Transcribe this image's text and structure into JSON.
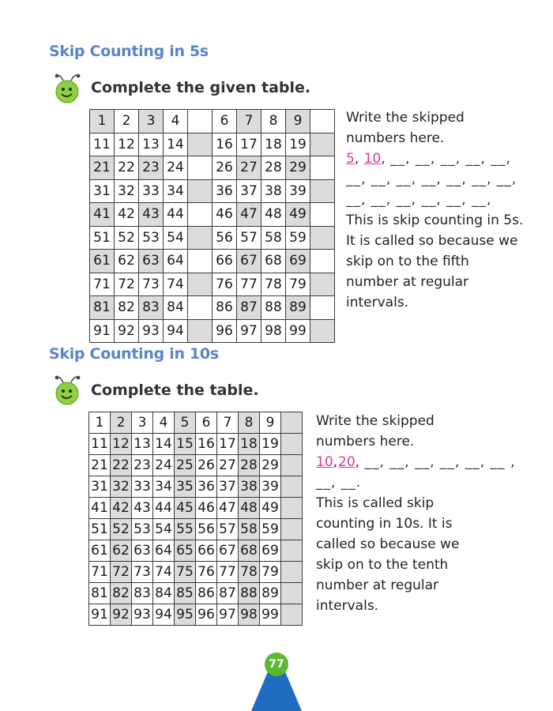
{
  "section1": {
    "title": "Skip Counting in 5s",
    "instruction": "Complete the given table.",
    "rows": [
      [
        "1",
        "2",
        "3",
        "4",
        "",
        "6",
        "7",
        "8",
        "9",
        ""
      ],
      [
        "11",
        "12",
        "13",
        "14",
        "",
        "16",
        "17",
        "18",
        "19",
        ""
      ],
      [
        "21",
        "22",
        "23",
        "24",
        "",
        "26",
        "27",
        "28",
        "29",
        ""
      ],
      [
        "31",
        "32",
        "33",
        "34",
        "",
        "36",
        "37",
        "38",
        "39",
        ""
      ],
      [
        "41",
        "42",
        "43",
        "44",
        "",
        "46",
        "47",
        "48",
        "49",
        ""
      ],
      [
        "51",
        "52",
        "53",
        "54",
        "",
        "56",
        "57",
        "58",
        "59",
        ""
      ],
      [
        "61",
        "62",
        "63",
        "64",
        "",
        "66",
        "67",
        "68",
        "69",
        ""
      ],
      [
        "71",
        "72",
        "73",
        "74",
        "",
        "76",
        "77",
        "78",
        "79",
        ""
      ],
      [
        "81",
        "82",
        "83",
        "84",
        "",
        "86",
        "87",
        "88",
        "89",
        ""
      ],
      [
        "91",
        "92",
        "93",
        "94",
        "",
        "96",
        "97",
        "98",
        "99",
        ""
      ]
    ],
    "side_heading": [
      "Write the skipped",
      "numbers here."
    ],
    "answers": [
      "5",
      "10"
    ],
    "blank_line_1": "__, __, __, __, __,",
    "blank_line_2": "__, __, __, __, __, __, __,",
    "blank_line_3": "__, __, __, __, __, __,",
    "explanation": [
      "This is skip counting in 5s.",
      "It is called so because we",
      "skip on to the fifth",
      "number at regular",
      "intervals."
    ]
  },
  "section2": {
    "title": "Skip Counting in 10s",
    "instruction": "Complete the table.",
    "rows": [
      [
        "1",
        "2",
        "3",
        "4",
        "5",
        "6",
        "7",
        "8",
        "9",
        ""
      ],
      [
        "11",
        "12",
        "13",
        "14",
        "15",
        "16",
        "17",
        "18",
        "19",
        ""
      ],
      [
        "21",
        "22",
        "23",
        "24",
        "25",
        "26",
        "27",
        "28",
        "29",
        ""
      ],
      [
        "31",
        "32",
        "33",
        "34",
        "35",
        "36",
        "37",
        "38",
        "39",
        ""
      ],
      [
        "41",
        "42",
        "43",
        "44",
        "45",
        "46",
        "47",
        "48",
        "49",
        ""
      ],
      [
        "51",
        "52",
        "53",
        "54",
        "55",
        "56",
        "57",
        "58",
        "59",
        ""
      ],
      [
        "61",
        "62",
        "63",
        "64",
        "65",
        "66",
        "67",
        "68",
        "69",
        ""
      ],
      [
        "71",
        "72",
        "73",
        "74",
        "75",
        "76",
        "77",
        "78",
        "79",
        ""
      ],
      [
        "81",
        "82",
        "83",
        "84",
        "85",
        "86",
        "87",
        "88",
        "89",
        ""
      ],
      [
        "91",
        "92",
        "93",
        "94",
        "95",
        "96",
        "97",
        "98",
        "99",
        ""
      ]
    ],
    "side_heading": [
      "Write the skipped",
      "numbers here."
    ],
    "answers": [
      "10",
      "20"
    ],
    "blank_line_1": "__, __, __, __, __, __ ,",
    "blank_line_2": "__, __.",
    "explanation": [
      "This is called skip",
      "counting in 10s. It is",
      "called so because we",
      "skip on to the tenth",
      "number at regular",
      "intervals."
    ]
  },
  "page_number": "77",
  "colors": {
    "title": "#5b83c6",
    "answer": "#e0359c",
    "shade": "#dcdcdc",
    "badge": "#5cb82e",
    "mountain": "#1f6cc0"
  }
}
